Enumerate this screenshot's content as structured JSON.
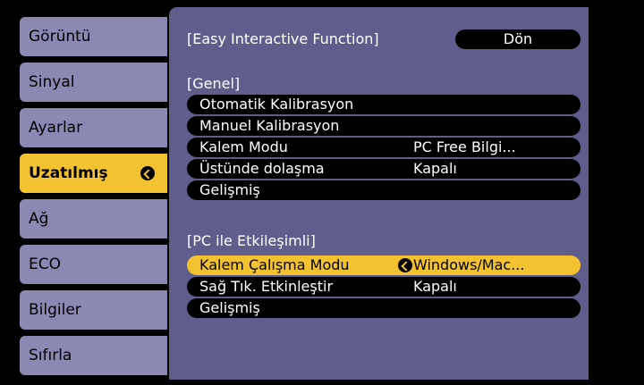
{
  "menu": {
    "tabs": [
      {
        "label": "Görüntü"
      },
      {
        "label": "Sinyal"
      },
      {
        "label": "Ayarlar"
      },
      {
        "label": "Uzatılmış"
      },
      {
        "label": "Ağ"
      },
      {
        "label": "ECO"
      },
      {
        "label": "Bilgiler"
      },
      {
        "label": "Sıfırla"
      }
    ],
    "active_index": 3
  },
  "panel": {
    "header": "[Easy Interactive Function]",
    "back_label": "Dön",
    "genel": {
      "title": "[Genel]",
      "items": [
        {
          "label": "Otomatik Kalibrasyon",
          "value": ""
        },
        {
          "label": "Manuel Kalibrasyon",
          "value": ""
        },
        {
          "label": "Kalem Modu",
          "value": "PC Free Bilgi..."
        },
        {
          "label": "Üstünde dolaşma",
          "value": "Kapalı"
        },
        {
          "label": "Gelişmiş",
          "value": ""
        }
      ]
    },
    "pc": {
      "title": "[PC ile Etkileşimli]",
      "items": [
        {
          "label": "Kalem Çalışma Modu",
          "value": "Windows/Mac..."
        },
        {
          "label": "Sağ Tık. Etkinleştir",
          "value": "Kapalı"
        },
        {
          "label": "Gelişmiş",
          "value": ""
        }
      ]
    }
  },
  "colors": {
    "tab_bg": "#8b88b4",
    "tab_active_bg": "#f2c230",
    "panel_bg": "#5f5d8b",
    "pill_bg": "#000000",
    "selected_bg": "#f2c230"
  }
}
